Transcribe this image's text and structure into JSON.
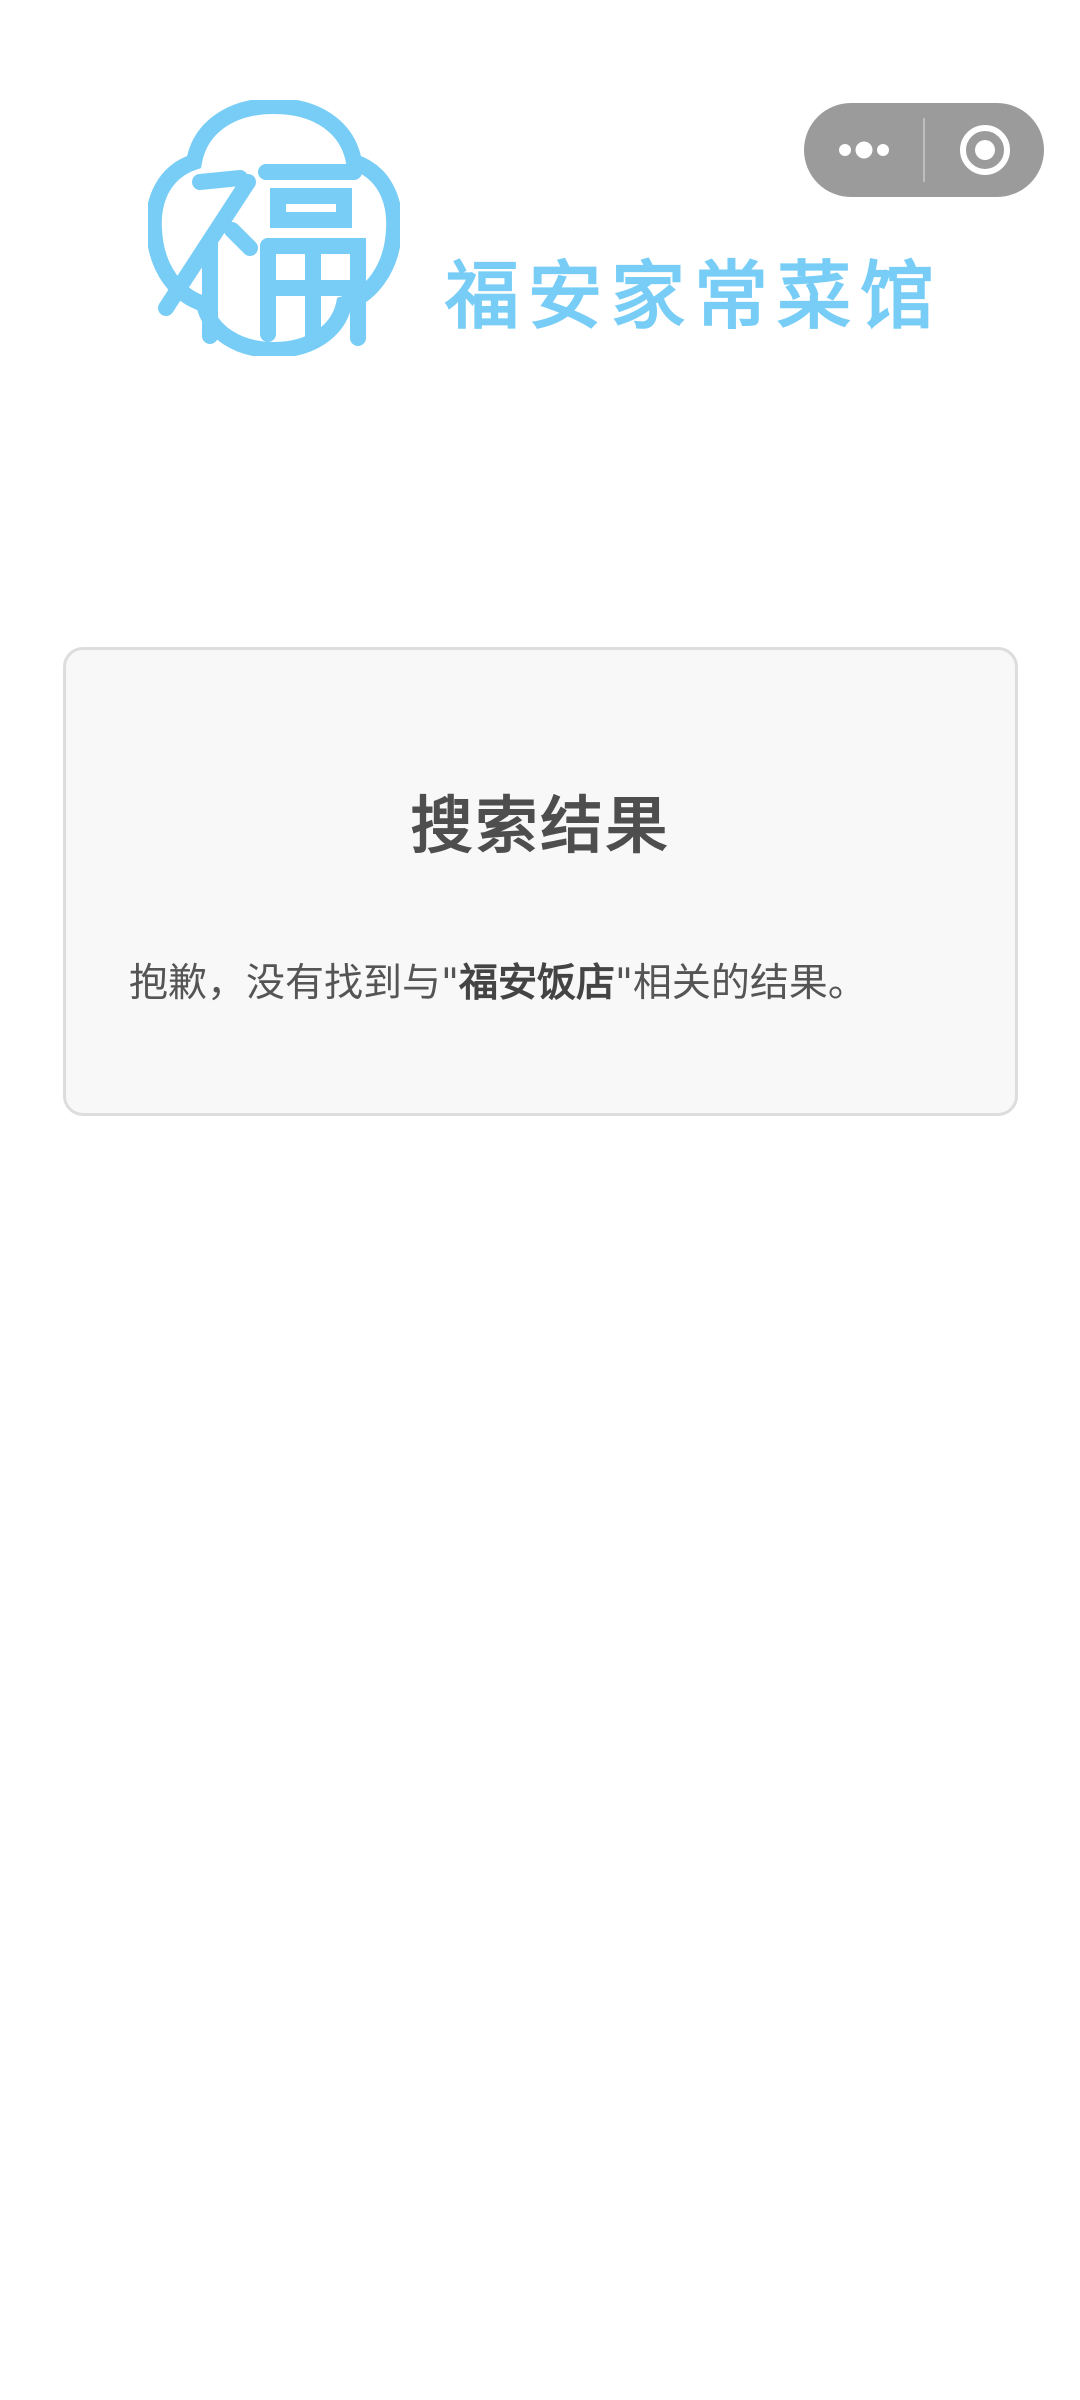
{
  "theme": {
    "logo_color": "#78cdf6",
    "capsule_bg": "#9b9b9b",
    "card_bg": "#f8f8f8",
    "card_border": "#dddddd"
  },
  "header": {
    "brand_name": "福安家常菜馆",
    "logo_icon": "fu-seal-logo-icon"
  },
  "capsule": {
    "more_icon": "more-dots-icon",
    "close_icon": "target-circle-icon"
  },
  "result": {
    "title": "搜索结果",
    "message_prefix": "抱歉，没有找到与\"",
    "keyword": "福安饭店",
    "message_suffix": "\"相关的结果。"
  }
}
